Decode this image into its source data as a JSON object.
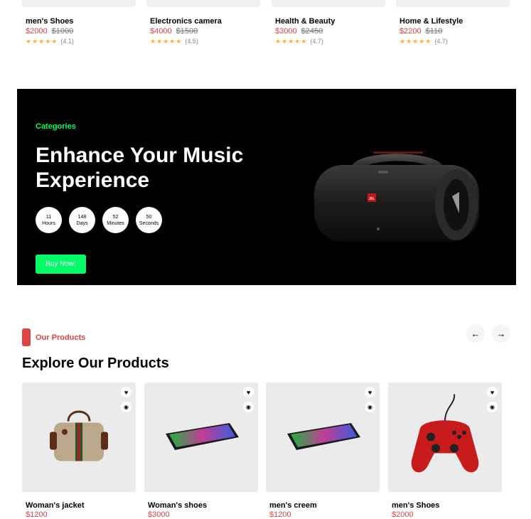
{
  "top_products": [
    {
      "name": "men's Shoes",
      "price": "$2000",
      "old_price": "$1000",
      "stars": "★★★★★",
      "count": "(4.1)"
    },
    {
      "name": "Electronics camera",
      "price": "$4000",
      "old_price": "$1500",
      "stars": "★★★★★",
      "count": "(4.5)"
    },
    {
      "name": "Health & Beauty",
      "price": "$3000",
      "old_price": "$2450",
      "stars": "★★★★★",
      "count": "(4.7)"
    },
    {
      "name": "Home & Lifestyle",
      "price": "$2200",
      "old_price": "$110",
      "stars": "★★★★★",
      "count": "(4.7)"
    }
  ],
  "banner": {
    "category": "Categories",
    "headline": "Enhance Your Music Experience",
    "timer": [
      {
        "value": "11",
        "unit": "Hours"
      },
      {
        "value": "148",
        "unit": "Days"
      },
      {
        "value": "52",
        "unit": "Minutes"
      },
      {
        "value": "50",
        "unit": "Seconds"
      }
    ],
    "buy_label": "Buy Now!",
    "speaker_badge": "JBL"
  },
  "products_section": {
    "tag": "Our Products",
    "title": "Explore Our Products",
    "prev_icon": "arrow-left-icon",
    "next_icon": "arrow-right-icon"
  },
  "products": [
    {
      "name": "Woman's jacket",
      "price": "$1200"
    },
    {
      "name": "Woman's shoes",
      "price": "$3000"
    },
    {
      "name": "men's creem",
      "price": "$1200"
    },
    {
      "name": "men's Shoes",
      "price": "$2000"
    }
  ],
  "colors": {
    "accent": "#db4444",
    "green": "#00ff66",
    "star": "#ffad33"
  }
}
